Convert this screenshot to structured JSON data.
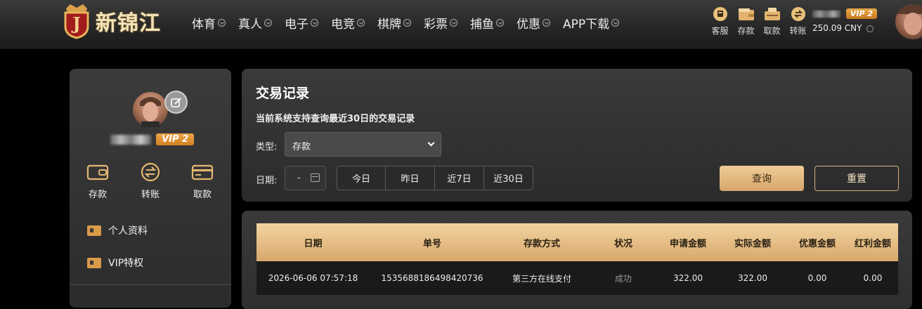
{
  "brand": {
    "logo_letter": "J",
    "name": "新锦江"
  },
  "nav": [
    "体育",
    "真人",
    "电子",
    "电竞",
    "棋牌",
    "彩票",
    "捕鱼",
    "优惠",
    "APP下载"
  ],
  "tools": [
    {
      "label": "客服",
      "icon": "customer-service-icon"
    },
    {
      "label": "存款",
      "icon": "wallet-icon"
    },
    {
      "label": "取款",
      "icon": "withdraw-icon"
    },
    {
      "label": "转账",
      "icon": "transfer-icon"
    }
  ],
  "user": {
    "vip": "VIP 2",
    "balance": "250.09 CNY"
  },
  "sidebar": {
    "vip": "VIP 2",
    "quick": [
      {
        "label": "存款",
        "icon": "wallet-icon"
      },
      {
        "label": "转账",
        "icon": "transfer-icon"
      },
      {
        "label": "取款",
        "icon": "card-icon"
      }
    ],
    "menu": [
      "个人资料",
      "VIP特权"
    ]
  },
  "page": {
    "title": "交易记录",
    "note": "当前系统支持查询最近30日的交易记录",
    "type_label": "类型:",
    "type_value": "存款",
    "date_label": "日期:",
    "date_value": "-",
    "ranges": [
      "今日",
      "昨日",
      "近7日",
      "近30日"
    ],
    "query": "查询",
    "reset": "重置"
  },
  "table": {
    "columns": [
      "日期",
      "单号",
      "存款方式",
      "状况",
      "申请金额",
      "实际金额",
      "优惠金额",
      "红利金额"
    ],
    "rows": [
      [
        "2026-06-06 07:57:18",
        "1535688186498420736",
        "第三方在线支付",
        "成功",
        "322.00",
        "322.00",
        "0.00",
        "0.00"
      ]
    ]
  },
  "colors": {
    "accent": "#d6a66a",
    "panel": "#333333",
    "background": "#000000"
  }
}
